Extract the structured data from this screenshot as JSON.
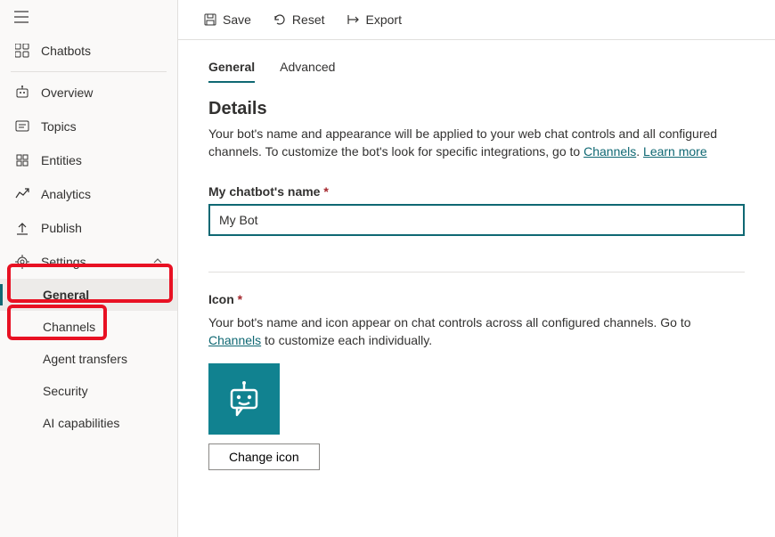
{
  "toolbar": {
    "save": "Save",
    "reset": "Reset",
    "export": "Export"
  },
  "sidebar": {
    "chatbots": "Chatbots",
    "overview": "Overview",
    "topics": "Topics",
    "entities": "Entities",
    "analytics": "Analytics",
    "publish": "Publish",
    "settings": "Settings",
    "sub": {
      "general": "General",
      "channels": "Channels",
      "agent_transfers": "Agent transfers",
      "security": "Security",
      "ai_capabilities": "AI capabilities"
    }
  },
  "tabs": {
    "general": "General",
    "advanced": "Advanced"
  },
  "details": {
    "title": "Details",
    "desc_part1": "Your bot's name and appearance will be applied to your web chat controls and all configured channels. To customize the bot's look for specific integrations, go to ",
    "link_channels": "Channels",
    "desc_sep": ". ",
    "link_learn": "Learn more",
    "name_label": "My chatbot's name ",
    "name_value": "My Bot",
    "icon_label": "Icon ",
    "icon_desc_part1": "Your bot's name and icon appear on chat controls across all configured channels. Go to ",
    "icon_desc_part2": " to customize each individually.",
    "change_icon": "Change icon"
  }
}
